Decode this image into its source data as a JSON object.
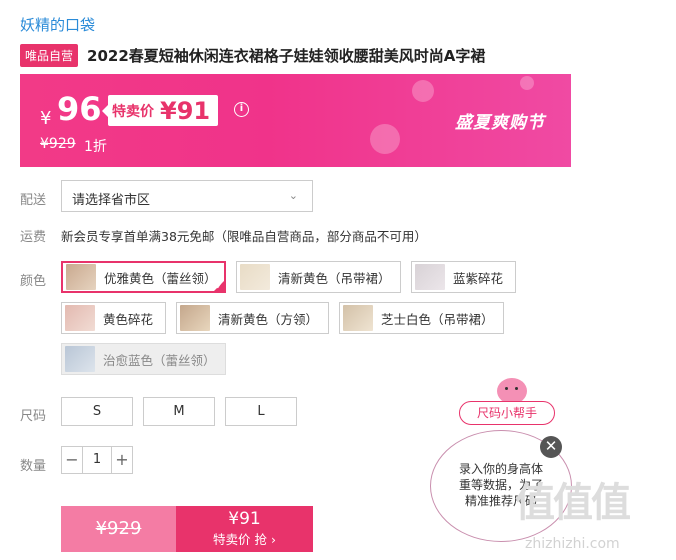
{
  "brand": "妖精的口袋",
  "product": {
    "tag": "唯品自营",
    "title": "2022春夏短袖休闲连衣裙格子娃娃领收腰甜美风时尚A字裙"
  },
  "price": {
    "currency_symbol": "¥",
    "current": "96",
    "special_label": "特卖价",
    "special_price": "¥91",
    "original": "¥929",
    "discount": "1折",
    "promo": "盛夏爽购节"
  },
  "delivery": {
    "label": "配送",
    "placeholder": "请选择省市区"
  },
  "shipping": {
    "label": "运费",
    "text": "新会员专享首单满38元免邮（限唯品自营商品，部分商品不可用）"
  },
  "colors": {
    "label": "颜色",
    "options": [
      {
        "label": "优雅黄色（蕾丝领）",
        "state": "selected"
      },
      {
        "label": "清新黄色（吊带裙）",
        "state": "normal"
      },
      {
        "label": "蓝紫碎花",
        "state": "normal"
      },
      {
        "label": "黄色碎花",
        "state": "normal"
      },
      {
        "label": "清新黄色（方领）",
        "state": "normal"
      },
      {
        "label": "芝士白色（吊带裙）",
        "state": "normal"
      },
      {
        "label": "治愈蓝色（蕾丝领）",
        "state": "disabled"
      }
    ]
  },
  "sizes": {
    "label": "尺码",
    "options": [
      "S",
      "M",
      "L"
    ]
  },
  "quantity": {
    "label": "数量",
    "value": "1",
    "minus": "−",
    "plus": "+"
  },
  "buy": {
    "original_price": "¥929",
    "special_price": "¥91",
    "action": "特卖价 抢 ›"
  },
  "size_helper": {
    "pill": "尺码小帮手",
    "tip_line1": "录入你的身高体",
    "tip_line2": "重等数据，为了",
    "tip_line3": "精准推荐尺码",
    "close": "✕"
  },
  "watermark": {
    "text": "值值值",
    "url": "zhizhizhi.com"
  }
}
